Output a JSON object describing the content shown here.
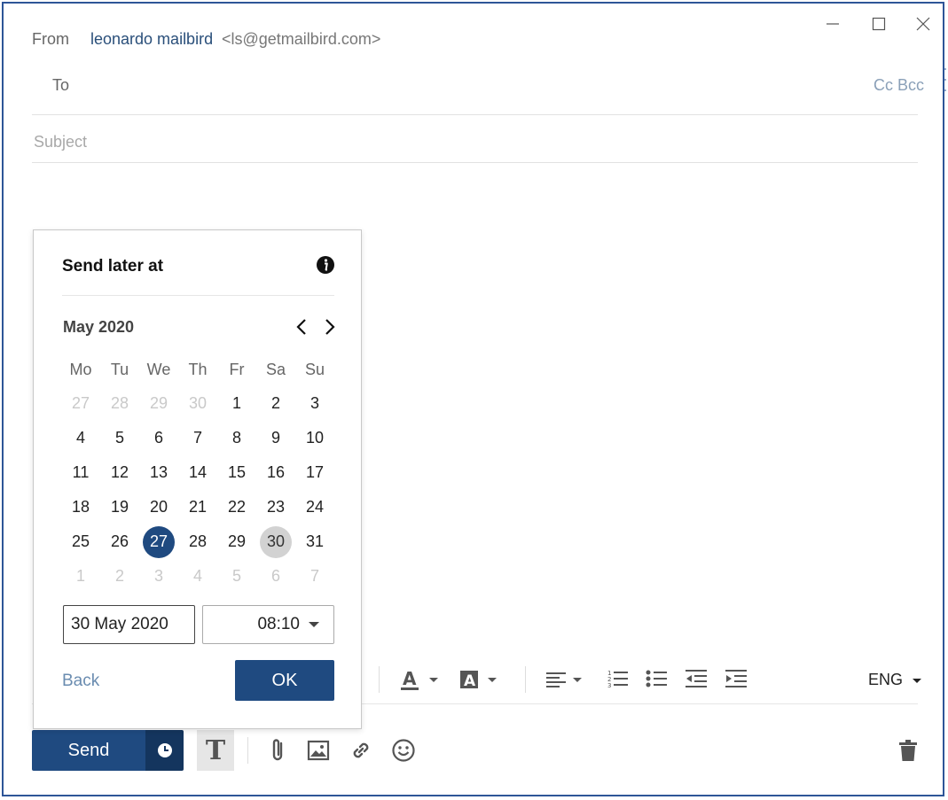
{
  "header": {
    "from_label": "From",
    "from_name": "leonardo mailbird",
    "from_email": "<ls@getmailbird.com>",
    "to_label": "To",
    "cc_bcc": "Cc Bcc",
    "subject_placeholder": "Subject"
  },
  "popup": {
    "title": "Send later at",
    "month": "May 2020",
    "weekdays": [
      "Mo",
      "Tu",
      "We",
      "Th",
      "Fr",
      "Sa",
      "Su"
    ],
    "days": [
      {
        "label": "27",
        "muted": true
      },
      {
        "label": "28",
        "muted": true
      },
      {
        "label": "29",
        "muted": true
      },
      {
        "label": "30",
        "muted": true
      },
      {
        "label": "1"
      },
      {
        "label": "2"
      },
      {
        "label": "3"
      },
      {
        "label": "4"
      },
      {
        "label": "5"
      },
      {
        "label": "6"
      },
      {
        "label": "7"
      },
      {
        "label": "8"
      },
      {
        "label": "9"
      },
      {
        "label": "10"
      },
      {
        "label": "11"
      },
      {
        "label": "12"
      },
      {
        "label": "13"
      },
      {
        "label": "14"
      },
      {
        "label": "15"
      },
      {
        "label": "16"
      },
      {
        "label": "17"
      },
      {
        "label": "18"
      },
      {
        "label": "19"
      },
      {
        "label": "20"
      },
      {
        "label": "21"
      },
      {
        "label": "22"
      },
      {
        "label": "23"
      },
      {
        "label": "24"
      },
      {
        "label": "25"
      },
      {
        "label": "26"
      },
      {
        "label": "27",
        "today": true
      },
      {
        "label": "28"
      },
      {
        "label": "29"
      },
      {
        "label": "30",
        "selected": true
      },
      {
        "label": "31"
      },
      {
        "label": "1",
        "muted": true
      },
      {
        "label": "2",
        "muted": true
      },
      {
        "label": "3",
        "muted": true
      },
      {
        "label": "4",
        "muted": true
      },
      {
        "label": "5",
        "muted": true
      },
      {
        "label": "6",
        "muted": true
      },
      {
        "label": "7",
        "muted": true
      }
    ],
    "date_value": "30 May 2020",
    "time_value": "08:10",
    "back_label": "Back",
    "ok_label": "OK"
  },
  "toolbar": {
    "lang": "ENG"
  },
  "bottom": {
    "send_label": "Send"
  },
  "icons": {
    "info": "info-icon",
    "prev": "chevron-left-icon",
    "next": "chevron-right-icon",
    "clock": "clock-icon",
    "attach": "paperclip-icon",
    "image": "image-icon",
    "link": "link-icon",
    "emoji": "emoji-icon",
    "trash": "trash-icon"
  },
  "colors": {
    "accent": "#1f4a80",
    "accent_dark": "#14355e",
    "window_border": "#2e5597",
    "link": "#6a8cb0"
  }
}
